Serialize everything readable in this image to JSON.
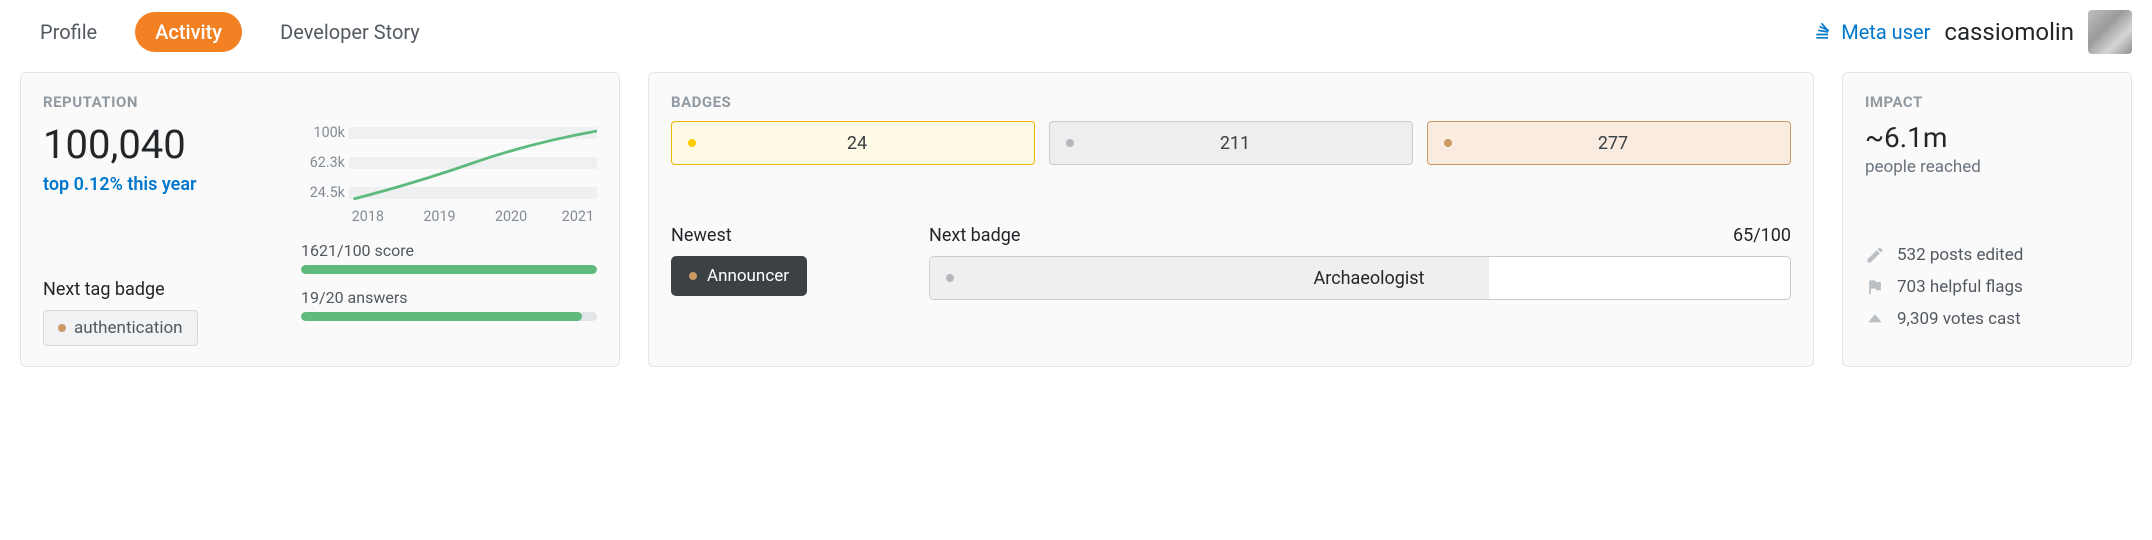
{
  "tabs": {
    "profile": "Profile",
    "activity": "Activity",
    "developer_story": "Developer Story"
  },
  "top_right": {
    "meta_user": "Meta user",
    "username": "cassiomolin"
  },
  "reputation": {
    "title": "REPUTATION",
    "value": "100,040",
    "rank": "top 0.12% this year",
    "next_tag_label": "Next tag badge",
    "next_tag_name": "authentication",
    "progress": {
      "score_label": "1621/100 score",
      "score_pct": 100,
      "answers_label": "19/20 answers",
      "answers_pct": 95
    }
  },
  "chart_data": {
    "type": "line",
    "title": "",
    "xlabel": "",
    "ylabel": "",
    "x_ticks": [
      "2018",
      "2019",
      "2020",
      "2021"
    ],
    "y_ticks": [
      "24.5k",
      "62.3k",
      "100k"
    ],
    "ylim": [
      24500,
      100000
    ],
    "series": [
      {
        "name": "reputation",
        "x": [
          2018,
          2019,
          2020,
          2021,
          2021.5
        ],
        "values": [
          24500,
          44000,
          66000,
          88000,
          100000
        ]
      }
    ]
  },
  "badges": {
    "title": "BADGES",
    "gold": 24,
    "silver": 211,
    "bronze": 277,
    "newest_label": "Newest",
    "newest_name": "Announcer",
    "next_label": "Next badge",
    "next_progress": "65/100",
    "next_pct": 65,
    "next_name": "Archaeologist"
  },
  "impact": {
    "title": "IMPACT",
    "big": "~6.1m",
    "sub": "people reached",
    "posts_edited": "532 posts edited",
    "helpful_flags": "703 helpful flags",
    "votes_cast": "9,309 votes cast"
  }
}
